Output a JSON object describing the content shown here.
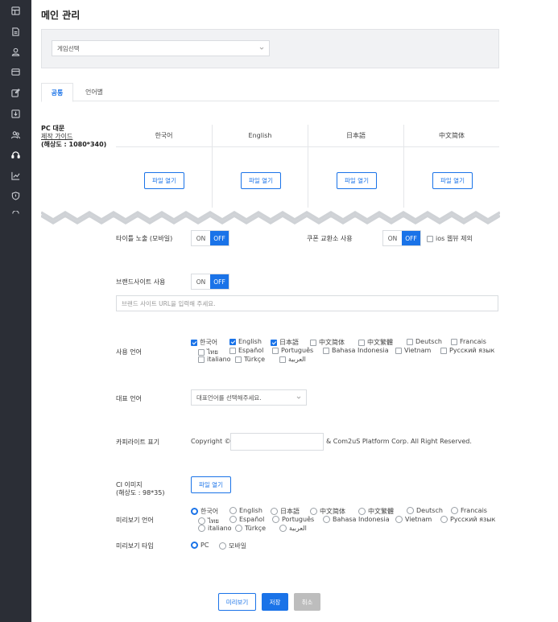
{
  "page_title": "메인 관리",
  "game_select": {
    "value": "게임선택"
  },
  "tabs": [
    {
      "label": "공통"
    },
    {
      "label": "언어별"
    }
  ],
  "pc_banner": {
    "title": "PC 대문",
    "guide_link": "제작 가이드",
    "resolution": "(해상도 : 1080*340)",
    "columns": [
      {
        "header": "한국어",
        "button": "파일 열기"
      },
      {
        "header": "English",
        "button": "파일 열기"
      },
      {
        "header": "日本語",
        "button": "파일 열기"
      },
      {
        "header": "中文简体",
        "button": "파일 열기"
      }
    ]
  },
  "title_exposure": {
    "label": "타이틀 노출 (모바일)",
    "on": "ON",
    "off": "OFF",
    "selected": "OFF"
  },
  "coupon": {
    "label": "쿠폰 교환소 사용",
    "on": "ON",
    "off": "OFF",
    "selected": "OFF",
    "ios_exclude": "ios 웹뷰 제외"
  },
  "brand_site": {
    "label": "브랜드사이트 사용",
    "on": "ON",
    "off": "OFF",
    "selected": "OFF",
    "url_placeholder": "브랜드 사이트 URL을 입력해 주세요."
  },
  "use_languages": {
    "label": "사용 언어",
    "options": [
      {
        "label": "한국어",
        "checked": true
      },
      {
        "label": "English",
        "checked": true
      },
      {
        "label": "日本語",
        "checked": true
      },
      {
        "label": "中文简体",
        "checked": false
      },
      {
        "label": "中文繁體",
        "checked": false
      },
      {
        "label": "Deutsch",
        "checked": false
      },
      {
        "label": "Francais",
        "checked": false
      },
      {
        "label": "ไทย",
        "checked": false
      },
      {
        "label": "Español",
        "checked": false
      },
      {
        "label": "Português",
        "checked": false
      },
      {
        "label": "Bahasa Indonesia",
        "checked": false
      },
      {
        "label": "Vietnam",
        "checked": false
      },
      {
        "label": "Русский язык",
        "checked": false
      },
      {
        "label": "italiano",
        "checked": false
      },
      {
        "label": "Türkçe",
        "checked": false
      },
      {
        "label": "العربية",
        "checked": false
      }
    ]
  },
  "default_language": {
    "label": "대표 언어",
    "placeholder": "대표언어를 선택해주세요."
  },
  "copyright": {
    "label": "카피라이트 표기",
    "prefix": "Copyright ©",
    "value": "",
    "suffix": "& Com2uS Platform Corp. All Right Reserved."
  },
  "ci_image": {
    "label": "CI 이미지",
    "resolution": "(해상도 : 98*35)",
    "button": "파일 열기"
  },
  "preview_language": {
    "label": "미리보기 언어",
    "selected": "한국어",
    "options": [
      {
        "label": "한국어"
      },
      {
        "label": "English"
      },
      {
        "label": "日本語"
      },
      {
        "label": "中文简体"
      },
      {
        "label": "中文繁體"
      },
      {
        "label": "Deutsch"
      },
      {
        "label": "Francais"
      },
      {
        "label": "ไทย"
      },
      {
        "label": "Español"
      },
      {
        "label": "Português"
      },
      {
        "label": "Bahasa Indonesia"
      },
      {
        "label": "Vietnam"
      },
      {
        "label": "Русский язык"
      },
      {
        "label": "italiano"
      },
      {
        "label": "Türkçe"
      },
      {
        "label": "العربية"
      }
    ]
  },
  "preview_type": {
    "label": "미리보기 타입",
    "selected": "PC",
    "options": [
      {
        "label": "PC"
      },
      {
        "label": "모바일"
      }
    ]
  },
  "actions": {
    "preview": "미리보기",
    "save": "저장",
    "cancel": "취소"
  },
  "colors": {
    "accent": "#1a73e8",
    "sidebar": "#2b2e36",
    "disabled": "#bdbdbd"
  },
  "sidebar_icons": [
    "dashboard-icon",
    "document-icon",
    "user-icon",
    "card-icon",
    "edit-icon",
    "download-box-icon",
    "users-icon",
    "headset-icon",
    "chart-icon",
    "shield-icon",
    "more-icon"
  ]
}
